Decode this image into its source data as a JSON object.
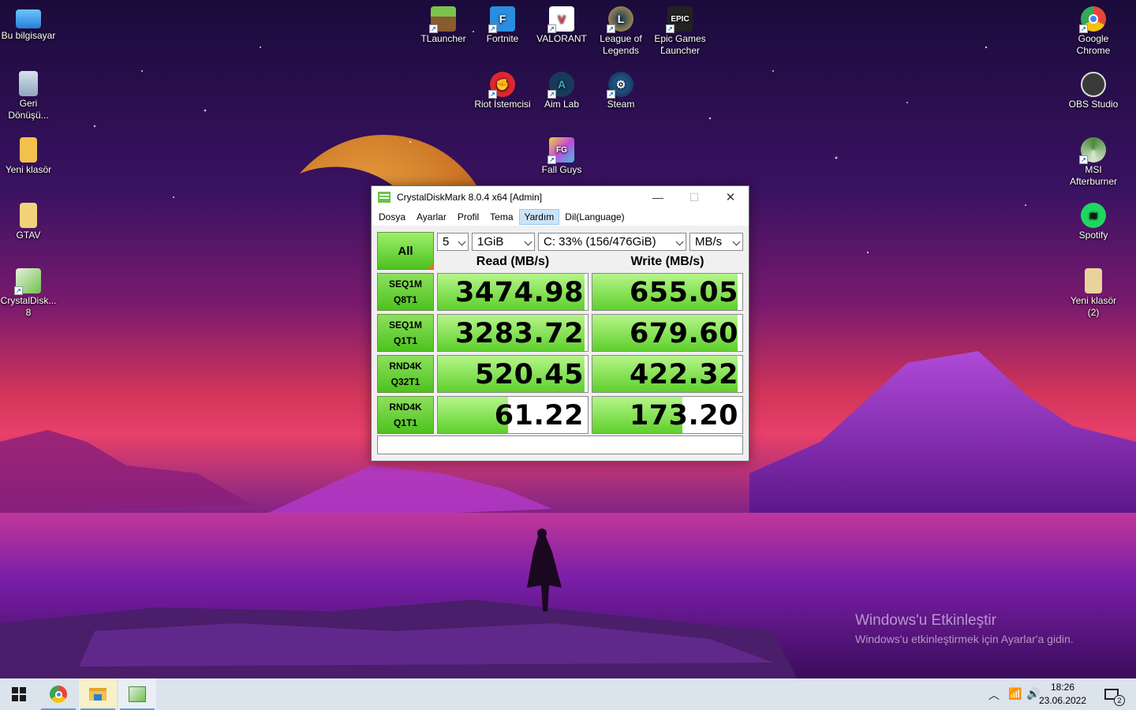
{
  "desktop": {
    "left_icons": [
      {
        "label": "Bu bilgisayar",
        "icon": "computer-icon",
        "color": "#3a9be8"
      },
      {
        "label": "Geri Dönüşü...",
        "icon": "recycle-bin-icon",
        "color": "#9fb3c8"
      },
      {
        "label": "Yeni klasör",
        "icon": "folder-icon",
        "color": "#f2c14e"
      },
      {
        "label": "GTAV",
        "icon": "folder-icon",
        "color": "#f2d27a"
      },
      {
        "label": "CrystalDisk... 8",
        "icon": "crystaldiskmark-icon",
        "color": "#6ec24a"
      }
    ],
    "top_icons": [
      {
        "label": "TLauncher",
        "icon": "tlauncher-icon",
        "color": "#5c9a3a"
      },
      {
        "label": "Fortnite",
        "icon": "fortnite-icon",
        "color": "#2b8de0"
      },
      {
        "label": "VALORANT",
        "icon": "valorant-icon",
        "color": "#e84057"
      },
      {
        "label": "League of Legends",
        "icon": "league-of-legends-icon",
        "color": "#c8a24a"
      },
      {
        "label": "Epic Games Launcher",
        "icon": "epic-games-icon",
        "color": "#222222"
      },
      {
        "label": "Riot İstemcisi",
        "icon": "riot-client-icon",
        "color": "#e0262c"
      },
      {
        "label": "Aim Lab",
        "icon": "aim-lab-icon",
        "color": "#2fb4c8"
      },
      {
        "label": "Steam",
        "icon": "steam-icon",
        "color": "#1b4a78"
      },
      {
        "label": "Fall Guys",
        "icon": "fall-guys-icon",
        "color": "#c04ad8"
      }
    ],
    "right_icons": [
      {
        "label": "Google Chrome",
        "icon": "chrome-icon",
        "color": "#e8453c"
      },
      {
        "label": "OBS Studio",
        "icon": "obs-icon",
        "color": "#3a3a3a"
      },
      {
        "label": "MSI Afterburner",
        "icon": "msi-afterburner-icon",
        "color": "#4a8a3a"
      },
      {
        "label": "Spotify",
        "icon": "spotify-icon",
        "color": "#1ed760"
      },
      {
        "label": "Yeni klasör (2)",
        "icon": "folder-icon",
        "color": "#e8d49a"
      }
    ]
  },
  "window": {
    "title": "CrystalDiskMark 8.0.4 x64 [Admin]",
    "controls": {
      "minimize": "—",
      "maximize": "☐",
      "close": "✕"
    },
    "menu": [
      "Dosya",
      "Ayarlar",
      "Profil",
      "Tema",
      "Yardım",
      "Dil(Language)"
    ],
    "menu_hover_index": 4,
    "all_button": "All",
    "count_select": "5",
    "size_select": "1GiB",
    "drive_select": "C: 33% (156/476GiB)",
    "unit_select": "MB/s",
    "read_header": "Read (MB/s)",
    "write_header": "Write (MB/s)",
    "rows": [
      {
        "line1": "SEQ1M",
        "line2": "Q8T1",
        "read": "3474.98",
        "write": "655.05",
        "read_level": 0.98,
        "write_level": 0.97
      },
      {
        "line1": "SEQ1M",
        "line2": "Q1T1",
        "read": "3283.72",
        "write": "679.60",
        "read_level": 0.98,
        "write_level": 0.97
      },
      {
        "line1": "RND4K",
        "line2": "Q32T1",
        "read": "520.45",
        "write": "422.32",
        "read_level": 0.98,
        "write_level": 0.97
      },
      {
        "line1": "RND4K",
        "line2": "Q1T1",
        "read": "61.22",
        "write": "173.20",
        "read_level": 0.47,
        "write_level": 0.6
      }
    ],
    "comment": "",
    "accent_green": "#4cc21e"
  },
  "activation": {
    "title": "Windows'u Etkinleştir",
    "subtitle": "Windows'u etkinleştirmek için Ayarlar'a gidin."
  },
  "taskbar": {
    "time": "18:26",
    "date": "23.06.2022",
    "notification_count": "2",
    "apps": [
      "start-icon",
      "chrome-icon",
      "file-explorer-icon",
      "crystaldiskmark-icon"
    ]
  }
}
